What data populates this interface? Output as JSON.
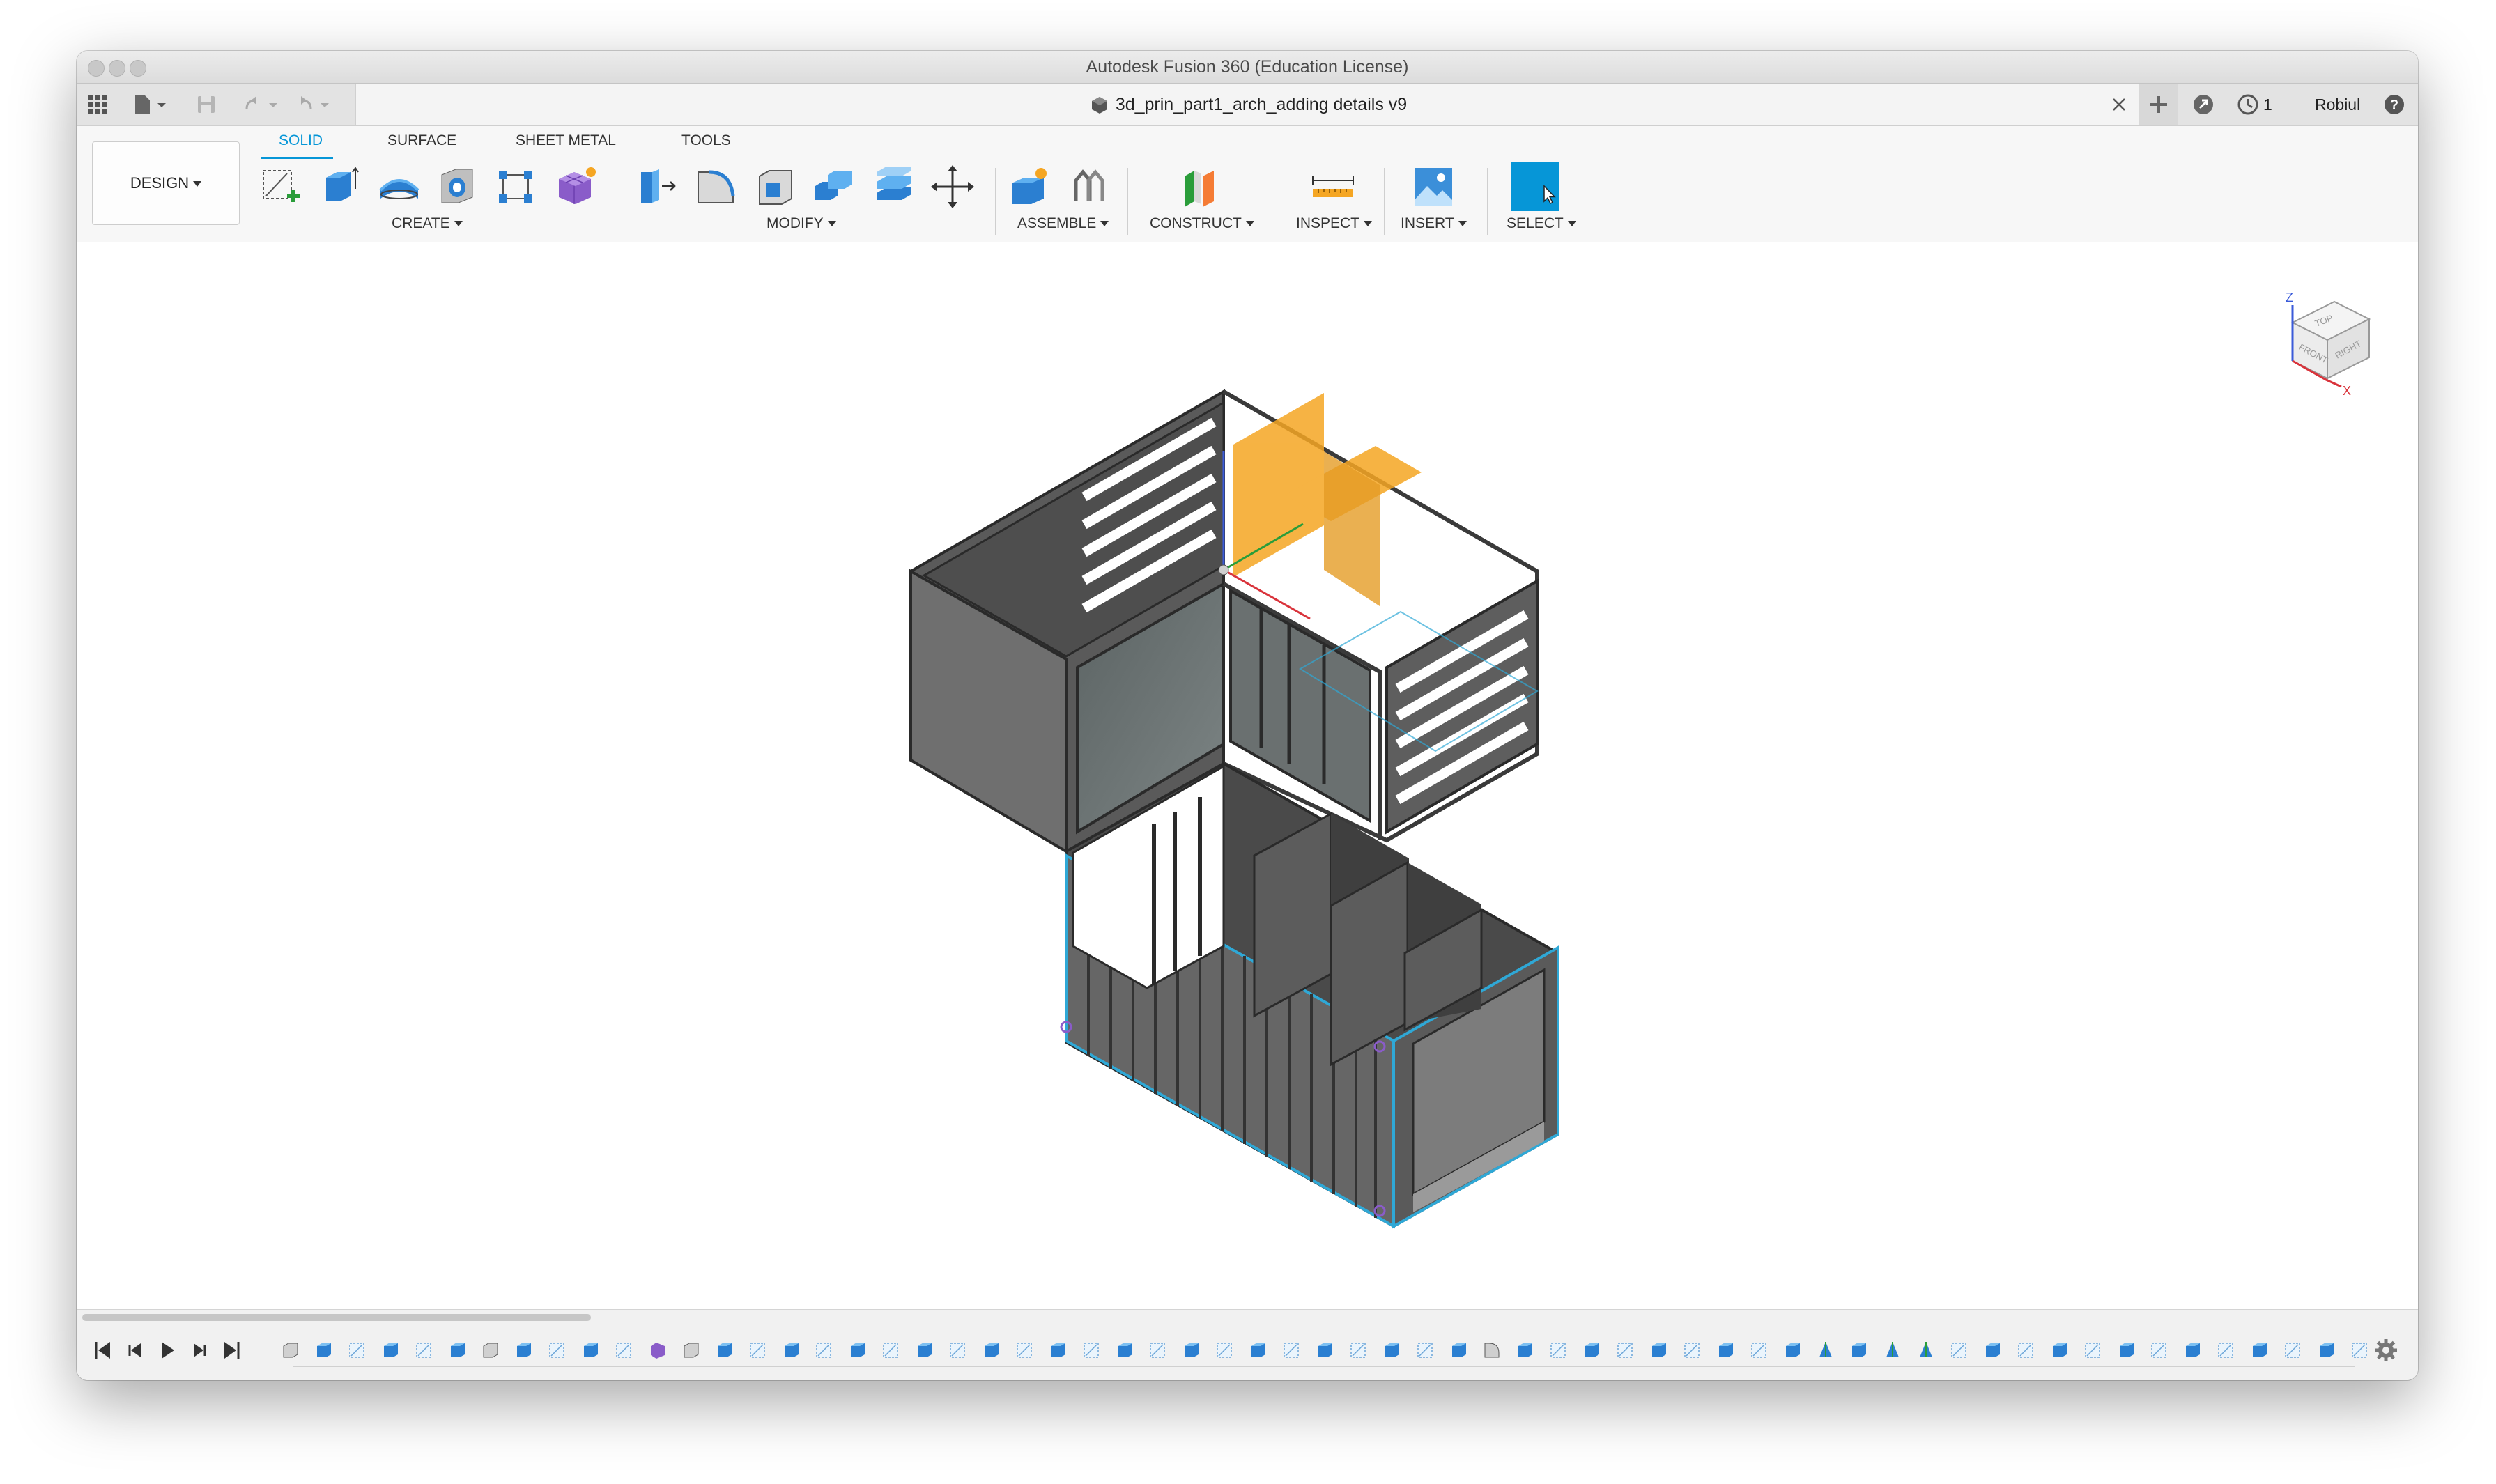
{
  "window": {
    "title": "Autodesk Fusion 360 (Education License)"
  },
  "tabbar": {
    "document_tab": "3d_prin_part1_arch_adding details v9",
    "job_count": "1",
    "user_name": "Robiul Hassan"
  },
  "ribbon": {
    "workspace": "DESIGN",
    "tabs": [
      {
        "label": "SOLID",
        "active": true
      },
      {
        "label": "SURFACE",
        "active": false
      },
      {
        "label": "SHEET METAL",
        "active": false
      },
      {
        "label": "TOOLS",
        "active": false
      }
    ],
    "groups": {
      "create": "CREATE",
      "modify": "MODIFY",
      "assemble": "ASSEMBLE",
      "construct": "CONSTRUCT",
      "inspect": "INSPECT",
      "insert": "INSERT",
      "select": "SELECT"
    }
  },
  "viewcube": {
    "top": "TOP",
    "front": "FRONT",
    "right": "RIGHT",
    "axis_x": "X",
    "axis_z": "Z"
  },
  "colors": {
    "accent": "#0696d7",
    "plane": "#f5a623",
    "model_dark": "#4d4d4d",
    "model_face": "#6e6e6e",
    "selection_edge": "#2fa8d6"
  },
  "timeline": {
    "controls": [
      "skip-to-start",
      "step-back",
      "play",
      "step-forward",
      "skip-to-end"
    ],
    "feature_count": 63
  }
}
